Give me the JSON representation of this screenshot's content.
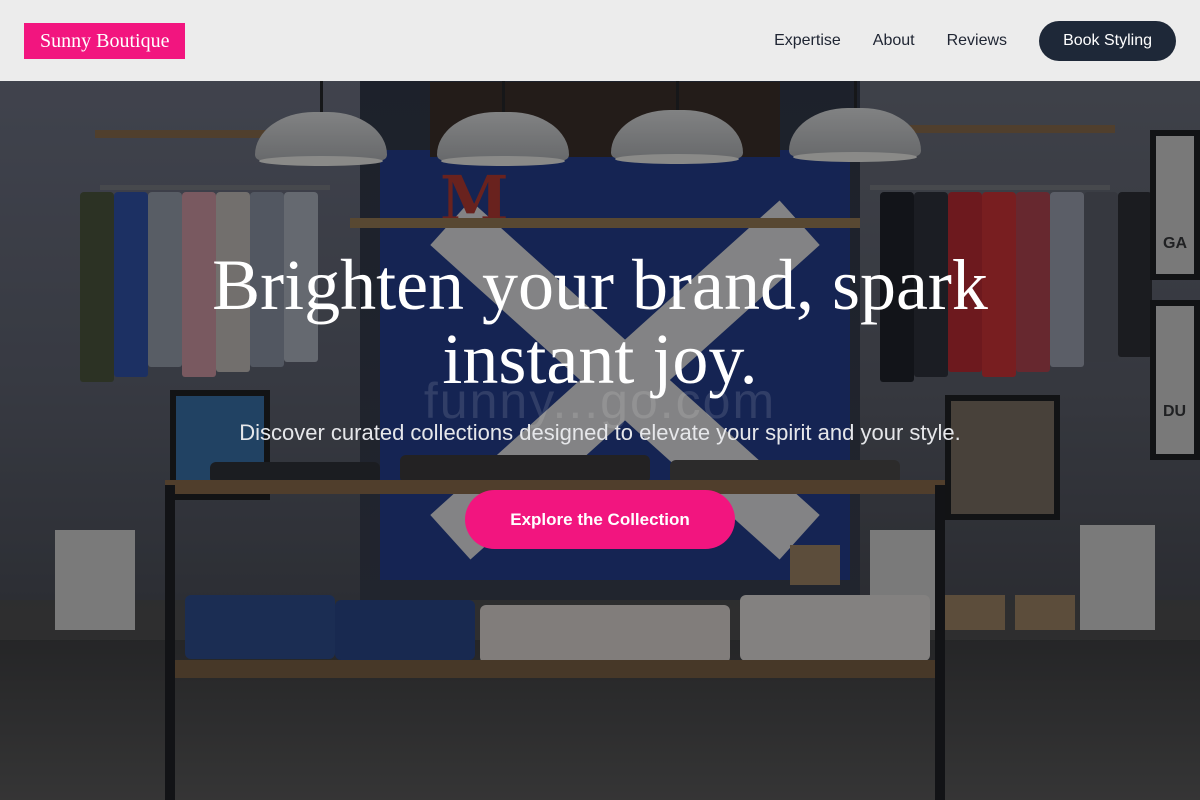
{
  "nav": {
    "brand": "Sunny Boutique",
    "links": [
      {
        "label": "Expertise"
      },
      {
        "label": "About"
      },
      {
        "label": "Reviews"
      }
    ],
    "cta": "Book Styling"
  },
  "hero": {
    "headline": "Brighten your brand, spark instant joy.",
    "subheadline": "Discover curated collections designed to elevate your spirit and your style.",
    "cta": "Explore the Collection",
    "background_image": "boutique clothing store interior with shelves, hanging garments and pendant lamps",
    "watermark": "funny...go.com"
  },
  "colors": {
    "accent": "#f2157f",
    "dark_button": "#1e2838",
    "nav_background": "#f3f3f3"
  }
}
